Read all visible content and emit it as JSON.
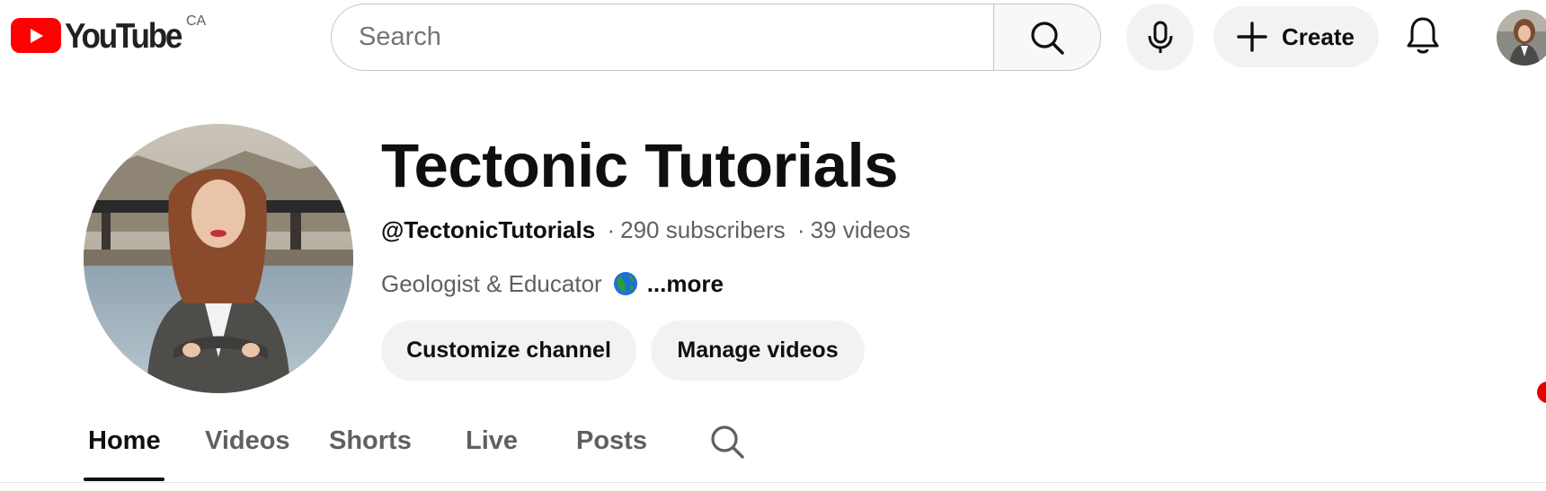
{
  "header": {
    "logo_text": "YouTube",
    "country_code": "CA",
    "search_placeholder": "Search",
    "create_label": "Create",
    "icons": {
      "search": "search-icon",
      "mic": "mic-icon",
      "create": "plus-icon",
      "notifications": "bell-icon"
    },
    "colors": {
      "brand_red": "#ff0000",
      "pill_bg": "#f2f2f2"
    }
  },
  "channel": {
    "name": "Tectonic Tutorials",
    "handle": "@TectonicTutorials",
    "separator": "·",
    "subscribers": "290 subscribers",
    "videos": "39 videos",
    "description": "Geologist & Educator",
    "more_label": "...more",
    "buttons": {
      "customize": "Customize channel",
      "manage": "Manage videos"
    }
  },
  "tabs": [
    {
      "label": "Home",
      "active": true
    },
    {
      "label": "Videos",
      "active": false
    },
    {
      "label": "Shorts",
      "active": false
    },
    {
      "label": "Live",
      "active": false
    },
    {
      "label": "Posts",
      "active": false
    }
  ]
}
